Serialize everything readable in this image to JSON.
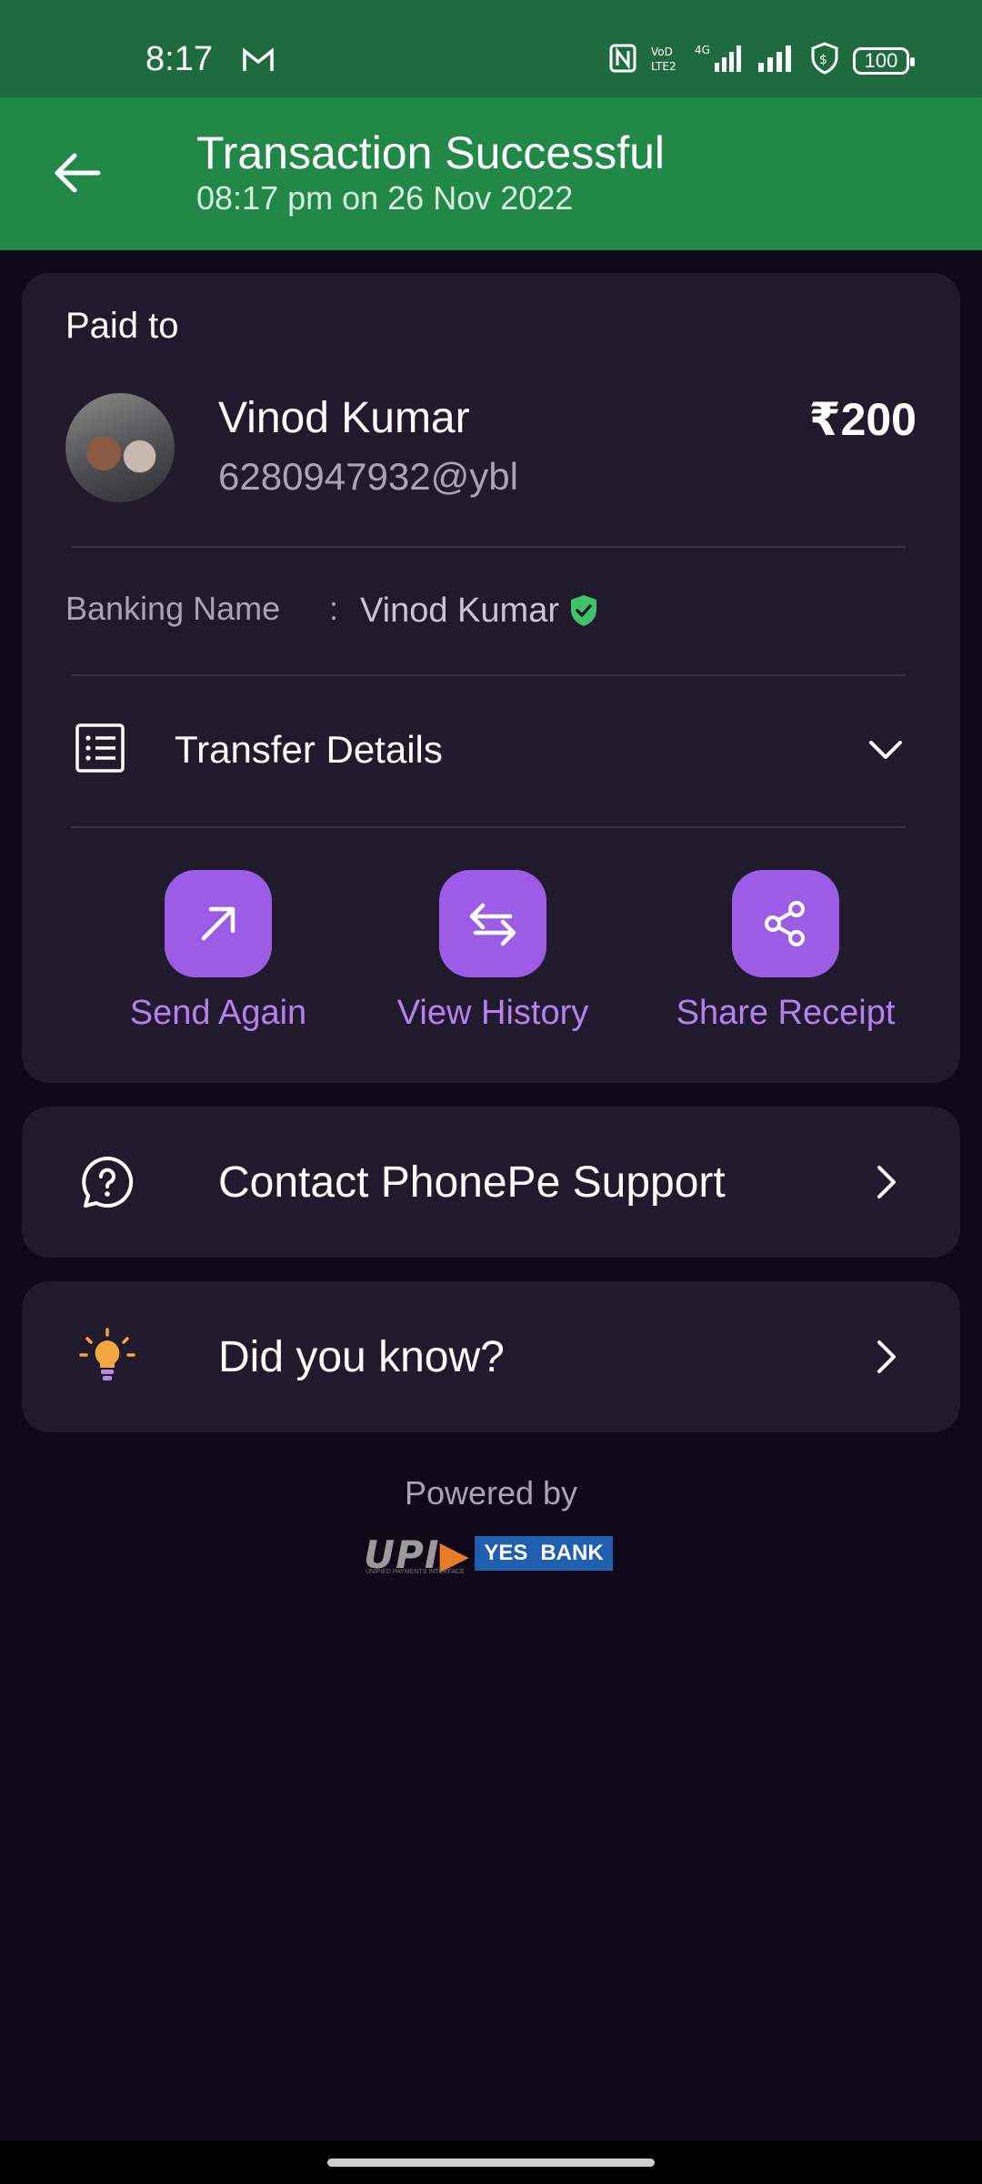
{
  "status_bar": {
    "time": "8:17",
    "battery": "100",
    "network": "4G",
    "volte": "Vo LTE2"
  },
  "header": {
    "title": "Transaction Successful",
    "subtitle": "08:17 pm on 26 Nov 2022"
  },
  "payment": {
    "paid_to_label": "Paid to",
    "payee_name": "Vinod Kumar",
    "payee_vpa": "6280947932@ybl",
    "amount": "₹200",
    "banking_name_label": "Banking Name",
    "banking_name_separator": ":",
    "banking_name": "Vinod Kumar"
  },
  "transfer_details": {
    "label": "Transfer Details"
  },
  "actions": [
    {
      "label": "Send Again",
      "icon": "arrow-up-right-icon"
    },
    {
      "label": "View History",
      "icon": "swap-arrows-icon"
    },
    {
      "label": "Share Receipt",
      "icon": "share-icon"
    }
  ],
  "rows": {
    "support_label": "Contact PhonePe Support",
    "did_you_know_label": "Did you know?"
  },
  "footer": {
    "powered_by": "Powered by",
    "upi_text": "UPI",
    "upi_subtext": "UNIFIED PAYMENTS INTERFACE",
    "bank_word1": "YES",
    "bank_word2": "BANK"
  },
  "colors": {
    "status_bar": "#1d6b3e",
    "header": "#218848",
    "background": "#0f0818",
    "card": "#211a2d",
    "accent": "#9d5ce6",
    "accent_text": "#b77ff0",
    "verified": "#3ec26a"
  }
}
